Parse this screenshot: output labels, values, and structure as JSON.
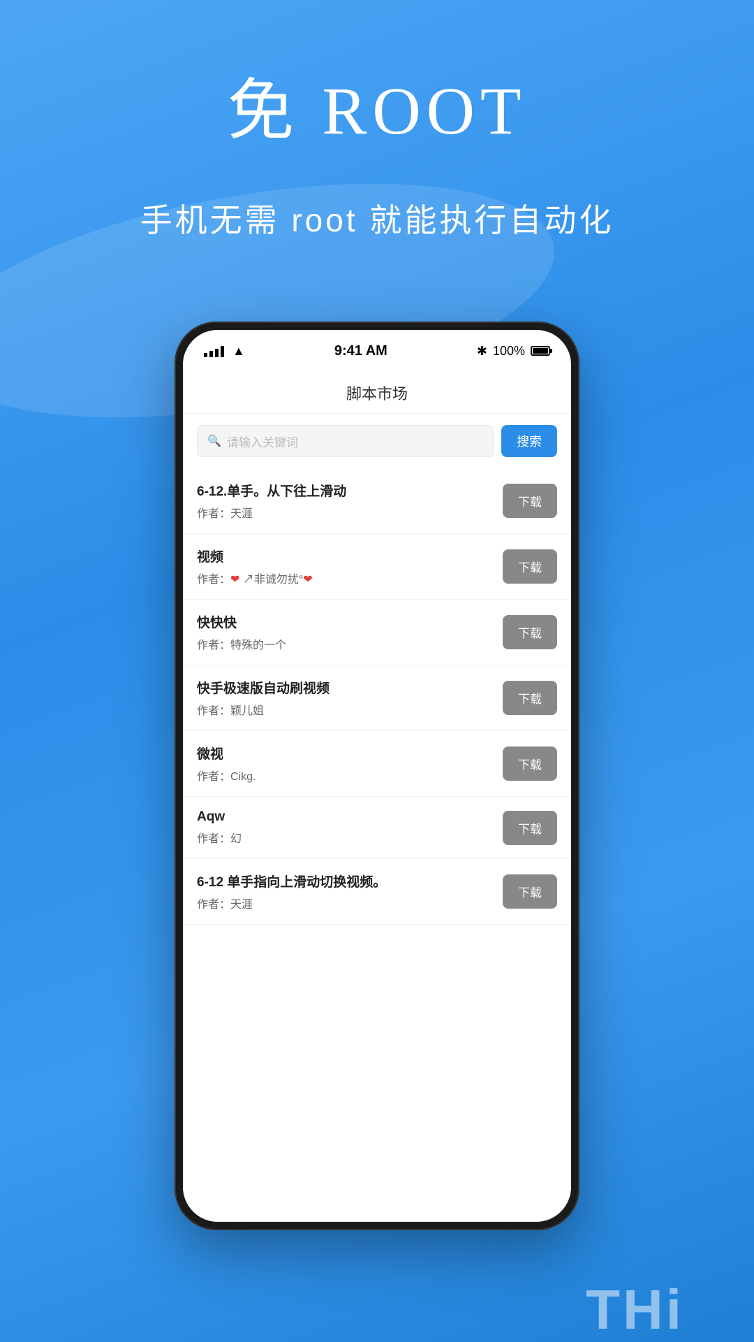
{
  "hero": {
    "title": "免 ROOT",
    "subtitle": "手机无需 root 就能执行自动化"
  },
  "phone": {
    "status_bar": {
      "time": "9:41 AM",
      "battery": "100%",
      "bluetooth": "✱"
    },
    "app_title": "脚本市场",
    "search": {
      "placeholder": "请输入关键词",
      "button_label": "搜索"
    },
    "scripts": [
      {
        "name": "6-12.单手。从下往上滑动",
        "author": "作者：天涯",
        "download_label": "下载"
      },
      {
        "name": "视频",
        "author_prefix": "作者：",
        "author": "❤ ↗非诚勿扰°❤",
        "download_label": "下载"
      },
      {
        "name": "快快快",
        "author": "作者：特殊的一个",
        "download_label": "下载"
      },
      {
        "name": "快手极速版自动刷视频",
        "author": "作者：颖儿姐",
        "download_label": "下载"
      },
      {
        "name": "微视",
        "author": "作者：Cikg.",
        "download_label": "下载"
      },
      {
        "name": "Aqw",
        "author": "作者：幻",
        "download_label": "下载"
      },
      {
        "name": "6-12 单手指向上滑动切换视频。",
        "author": "作者：天涯",
        "download_label": "下载",
        "partial": true
      }
    ]
  },
  "bottom": {
    "text": "THi"
  }
}
